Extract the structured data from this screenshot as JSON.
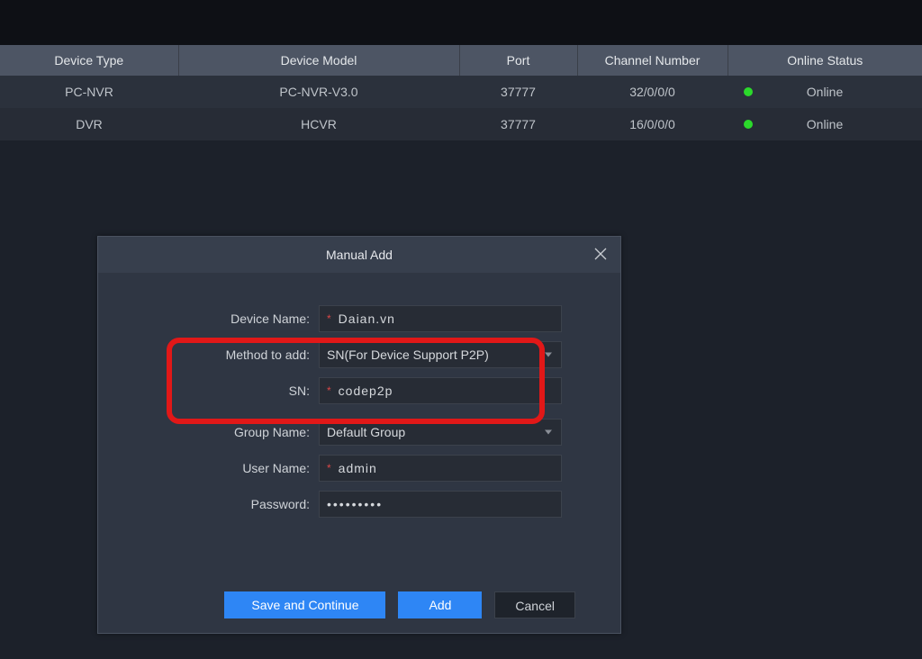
{
  "colors": {
    "accent": "#2e86f5",
    "status_ok": "#2bd92b",
    "highlight": "#e11818"
  },
  "table": {
    "headers": {
      "device_type": "Device Type",
      "device_model": "Device Model",
      "port": "Port",
      "channel_number": "Channel Number",
      "online_status": "Online Status"
    },
    "rows": [
      {
        "device_type": "PC-NVR",
        "device_model": "PC-NVR-V3.0",
        "port": "37777",
        "channel_number": "32/0/0/0",
        "online_status": "Online"
      },
      {
        "device_type": "DVR",
        "device_model": "HCVR",
        "port": "37777",
        "channel_number": "16/0/0/0",
        "online_status": "Online"
      }
    ]
  },
  "modal": {
    "title": "Manual Add",
    "labels": {
      "device_name": "Device Name:",
      "method_to_add": "Method to add:",
      "sn": "SN:",
      "group_name": "Group Name:",
      "user_name": "User Name:",
      "password": "Password:"
    },
    "values": {
      "device_name": "Daian.vn",
      "method_to_add": "SN(For Device Support P2P)",
      "sn": "codep2p",
      "group_name": "Default Group",
      "user_name": "admin",
      "password": "•••••••••"
    },
    "buttons": {
      "save_continue": "Save and Continue",
      "add": "Add",
      "cancel": "Cancel"
    }
  }
}
